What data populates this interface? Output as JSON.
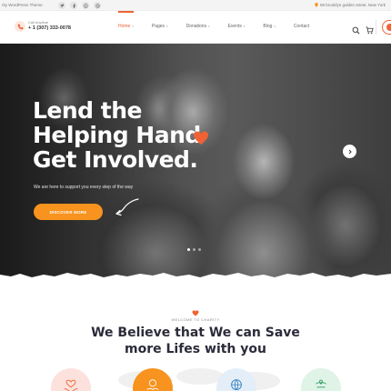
{
  "topbar": {
    "theme_text": "rity WordPress Theme",
    "social_icons": [
      "twitter-icon",
      "facebook-icon",
      "pinterest-icon",
      "instagram-icon"
    ],
    "address": "59 brooklyn golden street. New York"
  },
  "header": {
    "call_label": "Call Anytime",
    "phone": "+ 1 (307) 333-0078",
    "nav": [
      {
        "label": "Home",
        "active": true,
        "dropdown": true
      },
      {
        "label": "Pages",
        "active": false,
        "dropdown": true
      },
      {
        "label": "Donations",
        "active": false,
        "dropdown": true
      },
      {
        "label": "Events",
        "active": false,
        "dropdown": true
      },
      {
        "label": "Blog",
        "active": false,
        "dropdown": true
      },
      {
        "label": "Contact",
        "active": false,
        "dropdown": false
      }
    ],
    "icons": [
      "search-icon",
      "cart-icon"
    ]
  },
  "hero": {
    "headline_lines": [
      "Lend the",
      "Helping Hand",
      "Get Involved."
    ],
    "subtext": "We are here to support you every step of the way",
    "cta_label": "DISCOVER MORE",
    "slides": 3,
    "active_slide": 1
  },
  "about": {
    "eyebrow": "WELCOME TO CHARITY",
    "title_lines": [
      "We Believe that We can Save",
      "more Lifes with you"
    ],
    "features": [
      {
        "icon": "heart-hands-icon",
        "bg": "#fde1dc"
      },
      {
        "icon": "charity-icon",
        "bg": "#f7931e"
      },
      {
        "icon": "globe-icon",
        "bg": "#e3eef8"
      },
      {
        "icon": "hands-icon",
        "bg": "#dff3e6"
      }
    ]
  },
  "colors": {
    "accent": "#f06234",
    "cta": "#f7931e",
    "title": "#2b2b3a"
  }
}
